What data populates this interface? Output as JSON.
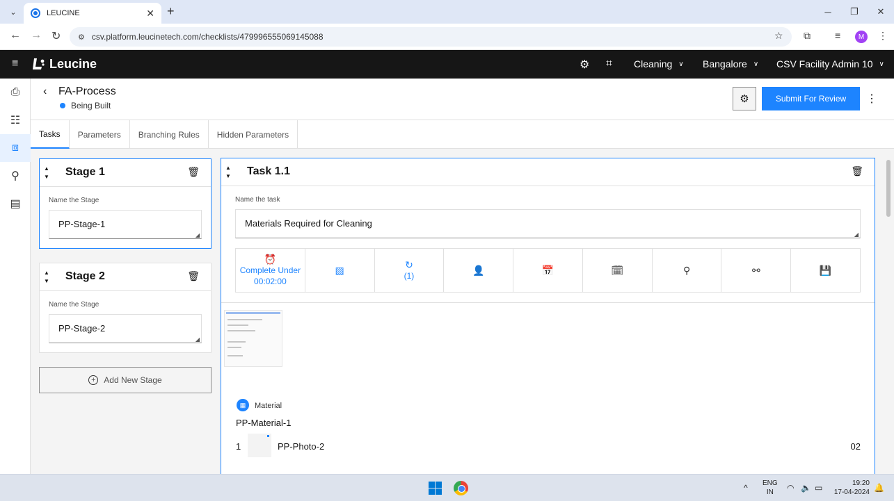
{
  "browser": {
    "tab_title": "LEUCINE",
    "url": "csv.platform.leucinetech.com/checklists/479996555069145088",
    "profile_initial": "M"
  },
  "app": {
    "logo_text": "Leucine",
    "dropdowns": [
      "Cleaning",
      "Bangalore",
      "CSV Facility Admin 10"
    ]
  },
  "page": {
    "title": "FA-Process",
    "status": "Being Built",
    "status_color": "#1d84ff",
    "submit_label": "Submit For Review",
    "accent": "#1d84ff"
  },
  "tabs": [
    "Tasks",
    "Parameters",
    "Branching Rules",
    "Hidden Parameters"
  ],
  "stages": [
    {
      "title": "Stage 1",
      "name_label": "Name the Stage",
      "name_value": "PP-Stage-1"
    },
    {
      "title": "Stage 2",
      "name_label": "Name the Stage",
      "name_value": "PP-Stage-2"
    }
  ],
  "add_stage_label": "Add New Stage",
  "task": {
    "title": "Task 1.1",
    "name_label": "Name the task",
    "name_value": "Materials Required for Cleaning",
    "complete_under_label": "Complete Under",
    "complete_under_time": "00:02:00",
    "recurrence_count": "(1)",
    "material": {
      "label": "Material",
      "name": "PP-Material-1",
      "index": "1",
      "photo_name": "PP-Photo-2",
      "quantity": "02"
    }
  },
  "taskbar": {
    "lang_line1": "ENG",
    "lang_line2": "IN",
    "time": "19:20",
    "date": "17-04-2024"
  }
}
